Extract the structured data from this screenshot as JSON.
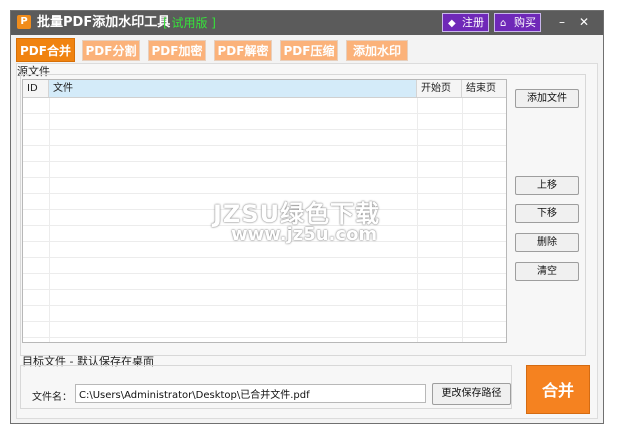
{
  "window": {
    "title": "批量PDF添加水印工具",
    "trial_badge": "[ 试用版 ]",
    "register_label": "注册",
    "buy_label": "购买",
    "minimize_label": "–",
    "close_label": "✕"
  },
  "tabs": [
    {
      "label": "PDF合并",
      "active": true
    },
    {
      "label": "PDF分割",
      "active": false
    },
    {
      "label": "PDF加密",
      "active": false
    },
    {
      "label": "PDF解密",
      "active": false
    },
    {
      "label": "PDF压缩",
      "active": false
    },
    {
      "label": "添加水印",
      "active": false
    }
  ],
  "source": {
    "label": "源文件",
    "columns": [
      "ID",
      "文件",
      "开始页",
      "结束页"
    ],
    "rows": []
  },
  "buttons": {
    "add_file": "添加文件",
    "up": "上移",
    "down": "下移",
    "delete": "删除",
    "clear": "清空",
    "change_path": "更改保存路径",
    "merge": "合并"
  },
  "target": {
    "label": "目标文件 - 默认保存在桌面",
    "file_name_label": "文件名：",
    "path_value": "C:\\Users\\Administrator\\Desktop\\已合并文件.pdf"
  },
  "watermark": {
    "line1": "JZSU绿色下载",
    "line2": "www.jz5u.com"
  },
  "colors": {
    "accent": "#f58220",
    "titlebar": "#5b5b5b",
    "tab_inactive": "#fbb27a",
    "title_button": "#6f28b8",
    "trial_text": "#36e23a",
    "header_highlight": "#d4ebf9"
  },
  "icons": {
    "app": "p-app-icon",
    "register": "diamond-register-icon",
    "buy": "cart-buy-icon"
  }
}
